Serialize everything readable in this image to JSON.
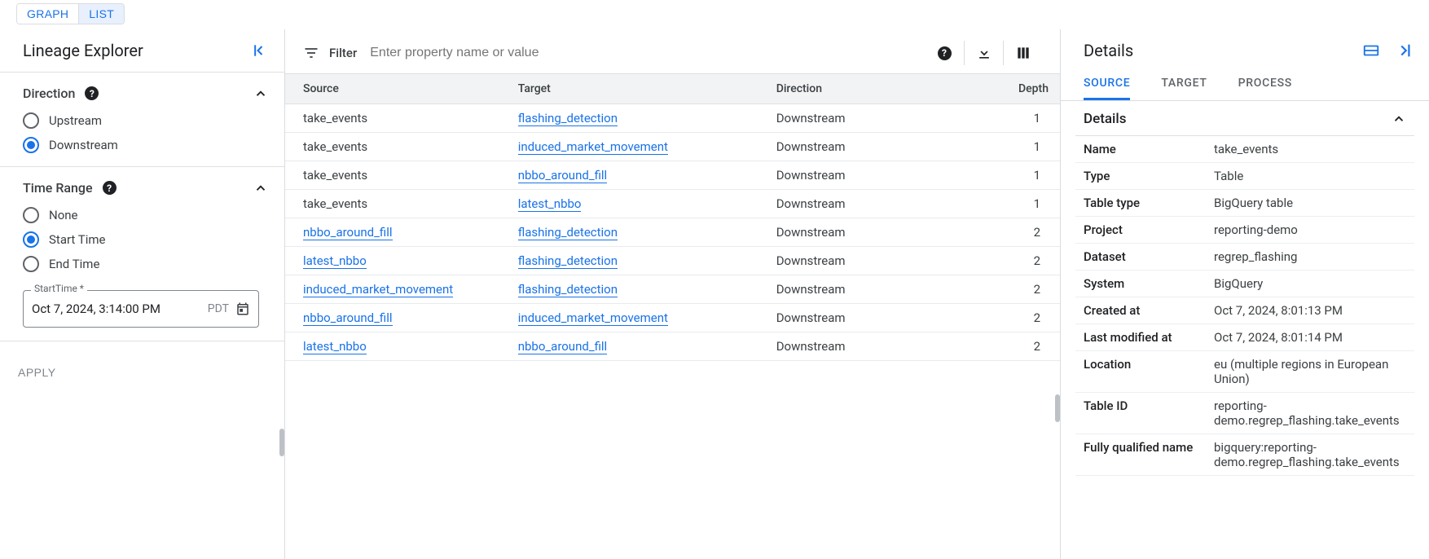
{
  "view_toggle": {
    "graph": "GRAPH",
    "list": "LIST"
  },
  "left": {
    "title": "Lineage Explorer",
    "direction": {
      "heading": "Direction",
      "upstream": "Upstream",
      "downstream": "Downstream"
    },
    "time_range": {
      "heading": "Time Range",
      "none": "None",
      "start_time": "Start Time",
      "end_time": "End Time",
      "field_label": "StartTime *",
      "value": "Oct 7, 2024, 3:14:00 PM",
      "tz": "PDT"
    },
    "apply": "APPLY"
  },
  "center": {
    "filter_label": "Filter",
    "filter_placeholder": "Enter property name or value",
    "columns": {
      "source": "Source",
      "target": "Target",
      "direction": "Direction",
      "depth": "Depth"
    },
    "rows": [
      {
        "source": "take_events",
        "source_link": false,
        "target": "flashing_detection",
        "target_link": true,
        "direction": "Downstream",
        "depth": "1"
      },
      {
        "source": "take_events",
        "source_link": false,
        "target": "induced_market_movement",
        "target_link": true,
        "direction": "Downstream",
        "depth": "1"
      },
      {
        "source": "take_events",
        "source_link": false,
        "target": "nbbo_around_fill",
        "target_link": true,
        "direction": "Downstream",
        "depth": "1"
      },
      {
        "source": "take_events",
        "source_link": false,
        "target": "latest_nbbo",
        "target_link": true,
        "direction": "Downstream",
        "depth": "1"
      },
      {
        "source": "nbbo_around_fill",
        "source_link": true,
        "target": "flashing_detection",
        "target_link": true,
        "direction": "Downstream",
        "depth": "2"
      },
      {
        "source": "latest_nbbo",
        "source_link": true,
        "target": "flashing_detection",
        "target_link": true,
        "direction": "Downstream",
        "depth": "2"
      },
      {
        "source": "induced_market_movement",
        "source_link": true,
        "target": "flashing_detection",
        "target_link": true,
        "direction": "Downstream",
        "depth": "2"
      },
      {
        "source": "nbbo_around_fill",
        "source_link": true,
        "target": "induced_market_movement",
        "target_link": true,
        "direction": "Downstream",
        "depth": "2"
      },
      {
        "source": "latest_nbbo",
        "source_link": true,
        "target": "nbbo_around_fill",
        "target_link": true,
        "direction": "Downstream",
        "depth": "2"
      }
    ]
  },
  "right": {
    "title": "Details",
    "tabs": {
      "source": "SOURCE",
      "target": "TARGET",
      "process": "PROCESS"
    },
    "details_heading": "Details",
    "kv": [
      {
        "k": "Name",
        "v": "take_events"
      },
      {
        "k": "Type",
        "v": "Table"
      },
      {
        "k": "Table type",
        "v": "BigQuery table"
      },
      {
        "k": "Project",
        "v": "reporting-demo"
      },
      {
        "k": "Dataset",
        "v": "regrep_flashing"
      },
      {
        "k": "System",
        "v": "BigQuery"
      },
      {
        "k": "Created at",
        "v": "Oct 7, 2024, 8:01:13 PM"
      },
      {
        "k": "Last modified at",
        "v": "Oct 7, 2024, 8:01:14 PM"
      },
      {
        "k": "Location",
        "v": "eu (multiple regions in European Union)"
      },
      {
        "k": "Table ID",
        "v": "reporting-demo.regrep_flashing.take_events"
      },
      {
        "k": "Fully qualified name",
        "v": "bigquery:reporting-demo.regrep_flashing.take_events"
      }
    ]
  }
}
